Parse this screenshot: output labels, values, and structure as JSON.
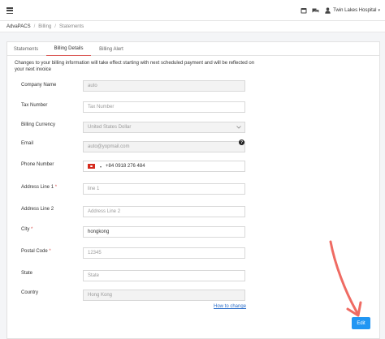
{
  "topbar": {
    "user_name": "Twin Lakes Hospital"
  },
  "breadcrumb": [
    "AdvaPACS",
    "Billing",
    "Statements"
  ],
  "tabs": [
    {
      "label": "Statements"
    },
    {
      "label": "Billing Details",
      "active": true
    },
    {
      "label": "Billing Alert"
    }
  ],
  "notice": "Changes to your billing information will take effect starting with next scheduled payment and will be reflected on your next invoice",
  "form": {
    "company_name": {
      "label": "Company Name",
      "value": "auto"
    },
    "tax_number": {
      "label": "Tax Number",
      "placeholder": "Tax Number"
    },
    "billing_currency": {
      "label": "Billing Currency",
      "value": "United States Dollar"
    },
    "email": {
      "label": "Email",
      "value": "auto@yopmail.com"
    },
    "phone": {
      "label": "Phone Number",
      "value": "+84 0918 276 484"
    },
    "address1": {
      "label": "Address Line 1",
      "placeholder": "line 1"
    },
    "address2": {
      "label": "Address Line 2",
      "placeholder": "Address Line 2"
    },
    "city": {
      "label": "City",
      "value": "hongkong"
    },
    "postal": {
      "label": "Postal Code",
      "value": "12345"
    },
    "state": {
      "label": "State",
      "placeholder": "State"
    },
    "country": {
      "label": "Country",
      "value": "Hong Kong"
    },
    "required_mark": "*"
  },
  "links": {
    "how_to_change": "How to change"
  },
  "actions": {
    "edit_label": "Edit"
  },
  "colors": {
    "accent": "#2196f3",
    "required": "#d9534f",
    "annotation_arrow": "#ef6b63"
  }
}
